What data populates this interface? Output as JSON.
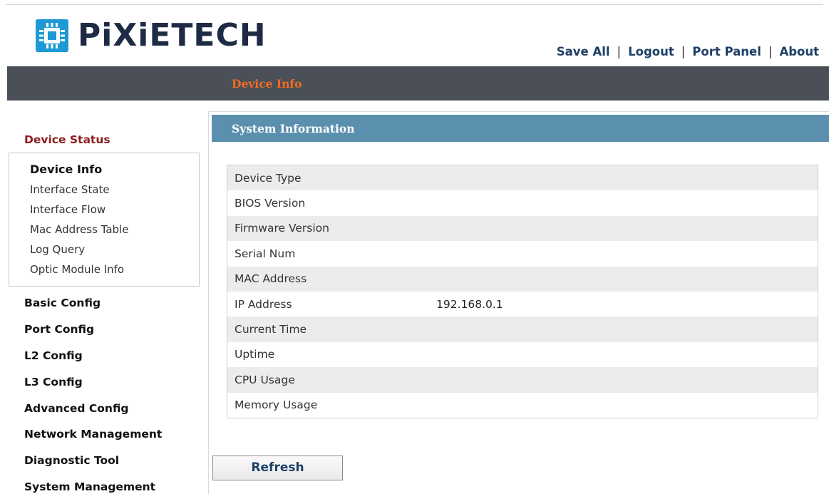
{
  "brand": {
    "name": "PiXiETECH",
    "logo_icon": "chip-icon",
    "logo_color": "#1d9ad6"
  },
  "top_links": [
    "Save All",
    "Logout",
    "Port Panel",
    "About"
  ],
  "nav": {
    "active_tab": "Device Info",
    "bar_color": "#4b5058",
    "accent": "#f36a21"
  },
  "sidebar": {
    "group_title": "Device Status",
    "sub_items": [
      "Device Info",
      "Interface State",
      "Interface Flow",
      "Mac Address Table",
      "Log Query",
      "Optic Module Info"
    ],
    "items": [
      "Basic Config",
      "Port Config",
      "L2 Config",
      "L3 Config",
      "Advanced Config",
      "Network Management",
      "Diagnostic Tool",
      "System Management"
    ]
  },
  "panel": {
    "title": "System Information",
    "header_color": "#5b8fae",
    "rows": [
      {
        "label": "Device Type",
        "value": ""
      },
      {
        "label": "BIOS Version",
        "value": ""
      },
      {
        "label": "Firmware Version",
        "value": ""
      },
      {
        "label": "Serial Num",
        "value": ""
      },
      {
        "label": "MAC Address",
        "value": ""
      },
      {
        "label": "IP Address",
        "value": "192.168.0.1"
      },
      {
        "label": "Current Time",
        "value": ""
      },
      {
        "label": "Uptime",
        "value": ""
      },
      {
        "label": "CPU Usage",
        "value": ""
      },
      {
        "label": "Memory Usage",
        "value": ""
      }
    ],
    "refresh_label": "Refresh"
  }
}
